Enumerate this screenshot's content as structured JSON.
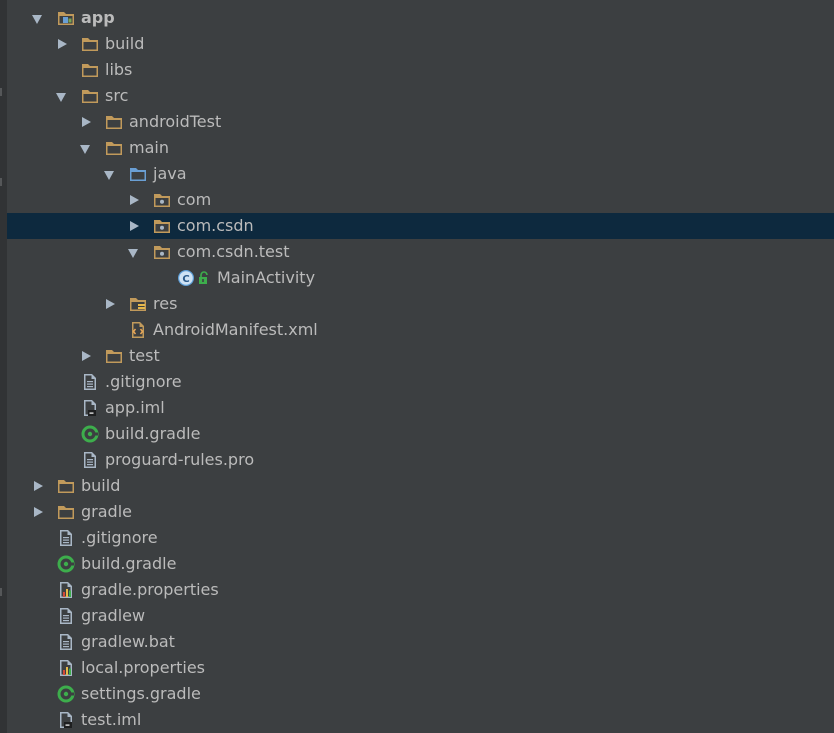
{
  "tree": {
    "items": [
      {
        "label": "app",
        "icon": "module-folder-icon",
        "arrow": "expanded"
      },
      {
        "label": "build",
        "icon": "folder-icon",
        "arrow": "collapsed"
      },
      {
        "label": "libs",
        "icon": "folder-icon",
        "arrow": "none"
      },
      {
        "label": "src",
        "icon": "folder-icon",
        "arrow": "expanded"
      },
      {
        "label": "androidTest",
        "icon": "folder-icon",
        "arrow": "collapsed"
      },
      {
        "label": "main",
        "icon": "folder-icon",
        "arrow": "expanded"
      },
      {
        "label": "java",
        "icon": "source-folder-icon",
        "arrow": "expanded"
      },
      {
        "label": "com",
        "icon": "package-icon",
        "arrow": "collapsed"
      },
      {
        "label": "com.csdn",
        "icon": "package-icon",
        "arrow": "collapsed",
        "selected": true
      },
      {
        "label": "com.csdn.test",
        "icon": "package-icon",
        "arrow": "expanded"
      },
      {
        "label": "MainActivity",
        "icon": "class-icon",
        "arrow": "none"
      },
      {
        "label": "res",
        "icon": "resource-folder-icon",
        "arrow": "collapsed"
      },
      {
        "label": "AndroidManifest.xml",
        "icon": "xml-file-icon",
        "arrow": "none"
      },
      {
        "label": "test",
        "icon": "folder-icon",
        "arrow": "collapsed"
      },
      {
        "label": ".gitignore",
        "icon": "text-file-icon",
        "arrow": "none"
      },
      {
        "label": "app.iml",
        "icon": "iml-file-icon",
        "arrow": "none"
      },
      {
        "label": "build.gradle",
        "icon": "gradle-icon",
        "arrow": "none"
      },
      {
        "label": "proguard-rules.pro",
        "icon": "text-file-icon",
        "arrow": "none"
      },
      {
        "label": "build",
        "icon": "folder-icon",
        "arrow": "collapsed"
      },
      {
        "label": "gradle",
        "icon": "folder-icon",
        "arrow": "collapsed"
      },
      {
        "label": ".gitignore",
        "icon": "text-file-icon",
        "arrow": "none"
      },
      {
        "label": "build.gradle",
        "icon": "gradle-icon",
        "arrow": "none"
      },
      {
        "label": "gradle.properties",
        "icon": "properties-file-icon",
        "arrow": "none"
      },
      {
        "label": "gradlew",
        "icon": "text-file-icon",
        "arrow": "none"
      },
      {
        "label": "gradlew.bat",
        "icon": "text-file-icon",
        "arrow": "none"
      },
      {
        "label": "local.properties",
        "icon": "properties-file-icon",
        "arrow": "none"
      },
      {
        "label": "settings.gradle",
        "icon": "gradle-icon",
        "arrow": "none"
      },
      {
        "label": "test.iml",
        "icon": "iml-file-icon",
        "arrow": "none"
      }
    ]
  },
  "colors": {
    "background": "#3c3f41",
    "selection": "#0d293e",
    "text": "#bbbbbb",
    "folder": "#c19a5b",
    "source_folder": "#6a9fd4",
    "gradle": "#3dae4c",
    "class_badge": "#5f9fd8"
  }
}
